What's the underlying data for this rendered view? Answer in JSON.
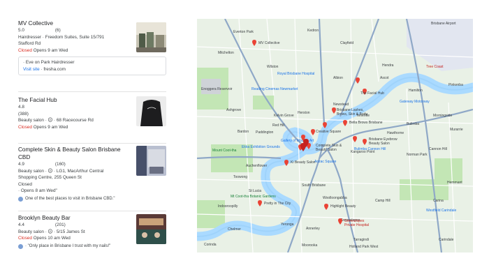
{
  "listings": [
    {
      "name": "MV Collective",
      "rating": "5.0",
      "reviews": "(6)",
      "details_line1": "Hairdresser · Freedom Suites, Suite 15/791",
      "details_line2": "Stafford Rd",
      "status": "Closed",
      "opens": "Opens 9 am Wed",
      "sponsor_name": "· Eve on Park Hairdresser",
      "visit_label": "Visit site",
      "visit_host": "· fresha.com"
    },
    {
      "name": "The Facial Hub",
      "rating": "4.8",
      "reviews": "(388)",
      "details": "Beauty salon · 🛈 · 68 Racecourse Rd",
      "status": "Closed",
      "opens": "Opens 9 am Wed"
    },
    {
      "name": "Complete Skin & Beauty Salon Brisbane CBD",
      "rating": "4.9",
      "reviews": "(160)",
      "details": "Beauty salon · 🛈 · LG1, MacArthur Central Shopping Centre, 255 Queen St",
      "status": "Closed",
      "opens": "· Opens 8 am Wed\"",
      "review": "One of the best places to visit in Brisbane CBD.\""
    },
    {
      "name": "Brooklyn Beauty Bar",
      "rating": "4.4",
      "reviews": "(201)",
      "details": "Beauty salon · 🛈 · 5/15 James St",
      "status": "Closed",
      "opens": "Opens 10 am Wed",
      "review": "· \"Only place in Brisbane I trust with my nails!\""
    }
  ],
  "map": {
    "colors": {
      "water": "#aadaff",
      "park": "#c3e6b5",
      "land": "#e9f1e6",
      "road": "#ffffff",
      "major": "#8fa8c7",
      "pin": "#ea4335"
    },
    "places": [
      "Everton Park",
      "Kedron",
      "Clayfield",
      "Hendra",
      "Ascot",
      "Brisbane Airport",
      "Mitchelton",
      "Wilston",
      "Albion",
      "Hamilton",
      "Ashgrove",
      "Kelvin Grove",
      "Herston",
      "Newstead",
      "Teneriffe",
      "Bardon",
      "Paddington",
      "Red Hill",
      "Bulimba",
      "Hawthorne",
      "Toowong",
      "Auchenflower",
      "Indooroopilly",
      "St Lucia",
      "South Brisbane",
      "Kangaroo Point",
      "Woolloongabba",
      "Morningside",
      "Camp Hill",
      "Chelmer",
      "Yeronga",
      "Annerley",
      "Greenslopes",
      "Carina",
      "Carindale",
      "Moorooka",
      "Tarragindi",
      "Holland Park West",
      "Corinda",
      "Morningside",
      "Hemmant",
      "Enoggera Reservoir",
      "Gilchrist Park",
      "Cannon Hill",
      "Murarrie",
      "Norman Park",
      "Pinkenba",
      "Mount Coot-tha"
    ],
    "pois": [
      "MV Collective",
      "The Facial Hub",
      "Brisbane Lashes, Brows, Skin & Body",
      "Bella Brows Brisbane",
      "Creative Square",
      "Complete Skin & Beauty Salon",
      "Brisbane Eyebrow Beauty Salon",
      "Ki Beauty Salon",
      "Pretty in The City",
      "Highlight Beauty",
      "Greenslopes Private Hospital",
      "Tree Coast",
      "Westfield Carindale",
      "Mt Coot-tha Botanic Gardens",
      "Gallery of Modern Art",
      "Reading Cinemas Newmarket",
      "Anzac Square",
      "Royal Brisbane Hospital",
      "Gateway Motorway",
      "Bulimba Cannon Hill",
      "Ekka Exhibition Grounds"
    ]
  }
}
